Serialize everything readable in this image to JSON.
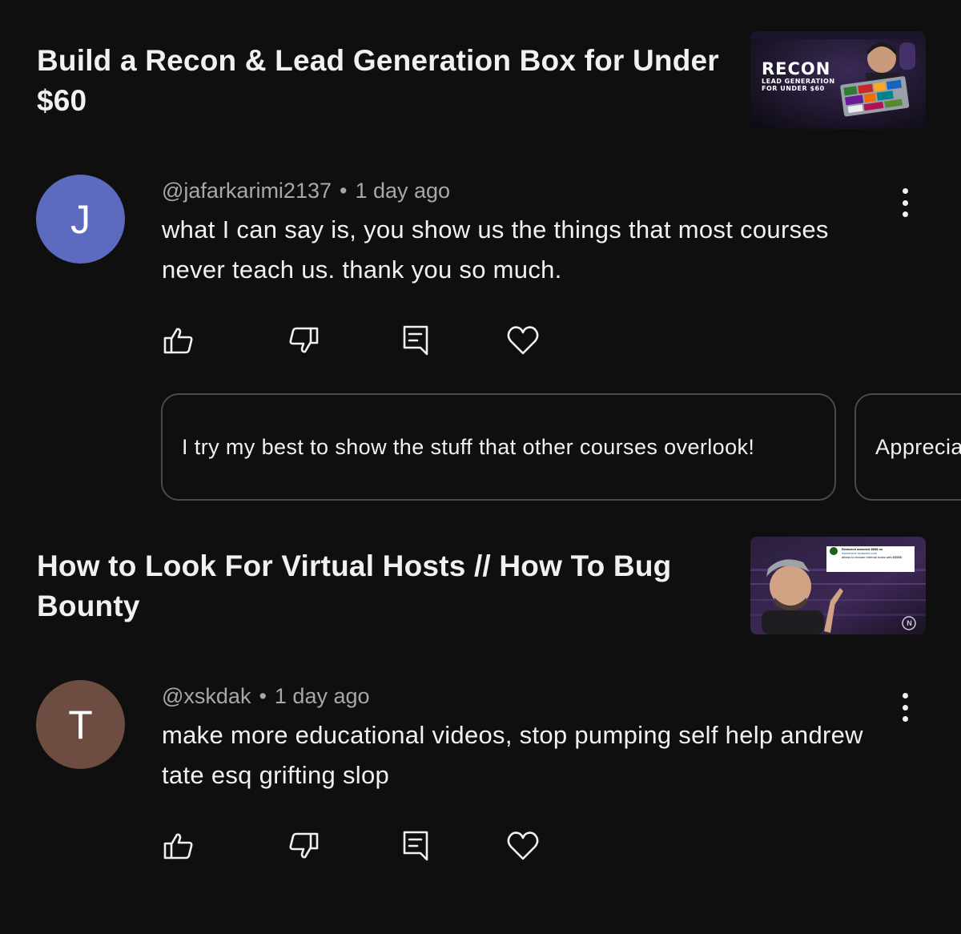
{
  "videos": [
    {
      "title": "Build a Recon & Lead Generation Box for Under $60",
      "thumbnail": {
        "headline": "RECON",
        "line2": "LEAD GENERATION",
        "line3": "FOR UNDER $60"
      },
      "comment": {
        "avatar_letter": "J",
        "avatar_color": "#5c6bc0",
        "handle": "@jafarkarimi2137",
        "separator": "•",
        "time": "1 day ago",
        "text": "what I can say is, you show us the things that most courses never teach us. thank you so much."
      },
      "suggested_replies": [
        "I try my best to show the stuff that other courses overlook!",
        "Apprecia"
      ]
    },
    {
      "title": "How to Look For Virtual Hosts // How To Bug Bounty",
      "thumbnail": {
        "popup_title": "Redacted awarded $$$$ on",
        "popup_link": "hackerone.redacted.com",
        "popup_text": "allows to browse internal hosts with $$$$$",
        "logo": "N"
      },
      "comment": {
        "avatar_letter": "T",
        "avatar_color": "#6d4c41",
        "handle": "@xskdak",
        "separator": "•",
        "time": "1 day ago",
        "text": "make more educational videos, stop pumping self help andrew tate esq grifting slop"
      }
    }
  ],
  "icons": {
    "like": "thumb-up-icon",
    "dislike": "thumb-down-icon",
    "reply": "reply-icon",
    "heart": "heart-icon",
    "more": "more-vert-icon"
  },
  "colors": {
    "background": "#0f0f0f",
    "text": "#f1f1f1",
    "meta": "#a8a8a8",
    "chip_border": "#4a4a4a"
  }
}
